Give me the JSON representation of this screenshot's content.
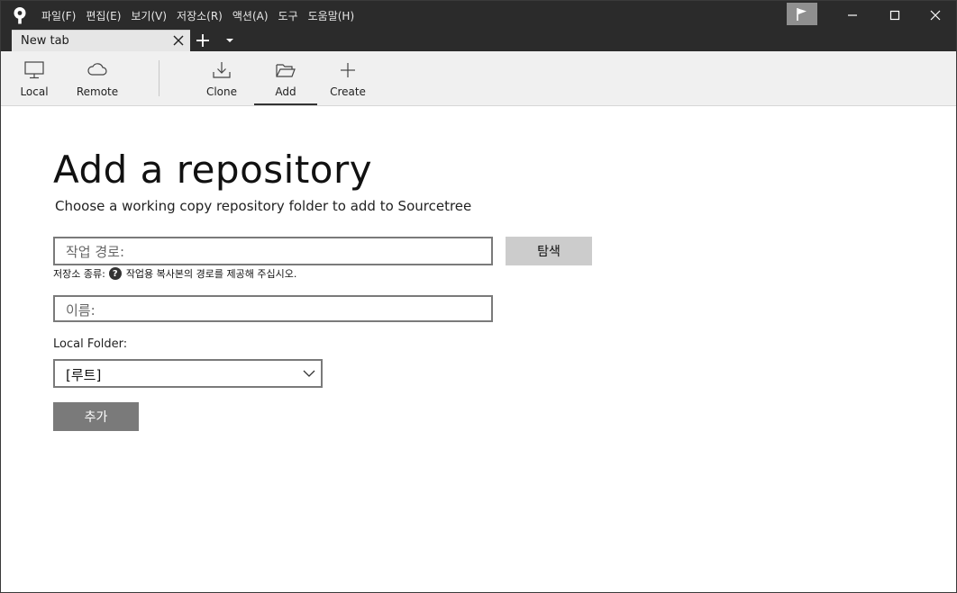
{
  "menu": [
    "파일(F)",
    "편집(E)",
    "보기(V)",
    "저장소(R)",
    "액션(A)",
    "도구",
    "도움말(H)"
  ],
  "tab": {
    "label": "New tab"
  },
  "toolbar": {
    "local": "Local",
    "remote": "Remote",
    "clone": "Clone",
    "add": "Add",
    "create": "Create"
  },
  "page": {
    "title": "Add a repository",
    "subtitle": "Choose a working copy repository folder to add to Sourcetree",
    "path_placeholder": "작업 경로:",
    "browse": "탐색",
    "repo_type_label": "저장소 종류:",
    "repo_type_help": "?",
    "repo_type_hint": "작업용 복사본의 경로를 제공해 주십시오.",
    "name_placeholder": "이름:",
    "local_folder_label": "Local Folder:",
    "local_folder_value": "[루트]",
    "add_button": "추가"
  },
  "colors": {
    "titlebar": "#2b2b2b",
    "toolbar": "#f0f0f0",
    "button_primary": "#7a7a7a",
    "button_secondary": "#cccccc"
  }
}
